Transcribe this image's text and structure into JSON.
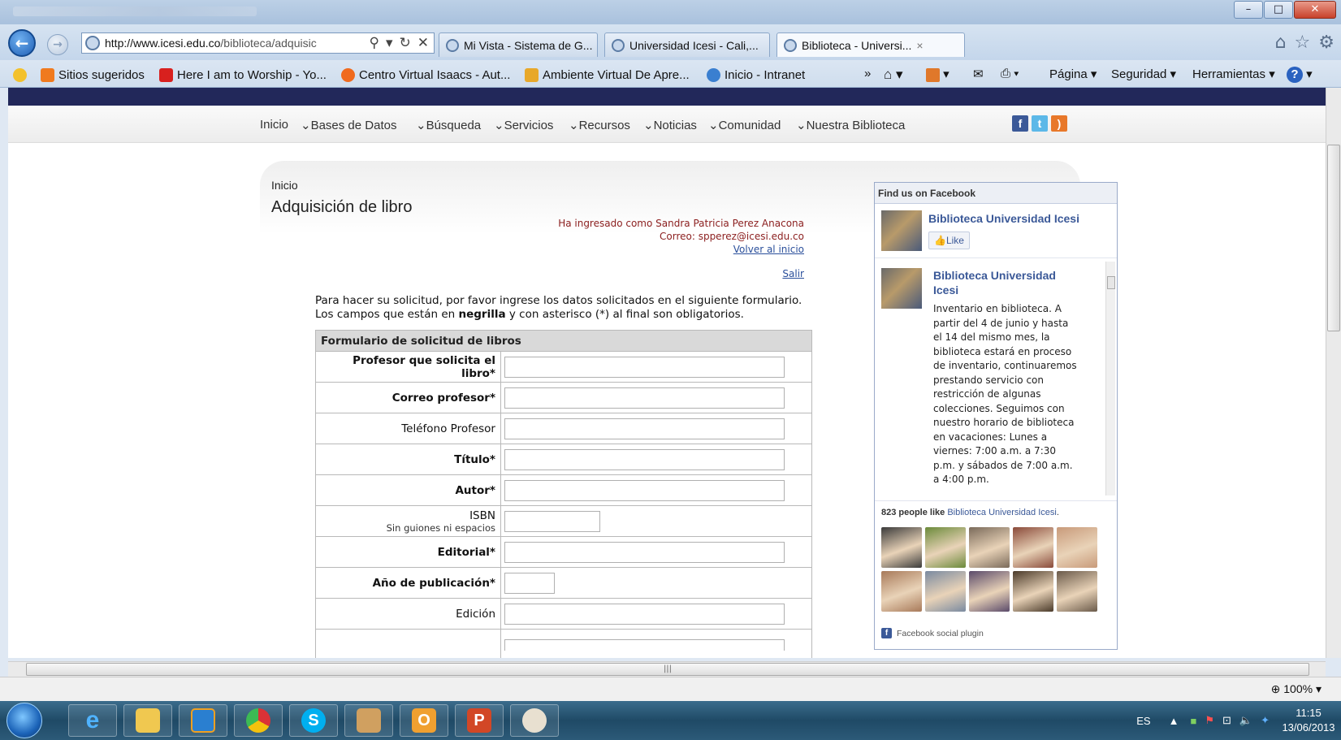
{
  "browser": {
    "url_domain": "http://www.icesi.edu.co",
    "url_path": "/biblioteca/adquisic",
    "tabs": [
      {
        "label": "Mi Vista - Sistema de G..."
      },
      {
        "label": "Universidad Icesi - Cali,..."
      },
      {
        "label": "Biblioteca - Universi..."
      }
    ],
    "favorites": [
      {
        "label": "Sitios sugeridos"
      },
      {
        "label": "Here I am to Worship - Yo..."
      },
      {
        "label": "Centro Virtual Isaacs - Aut..."
      },
      {
        "label": "Ambiente Virtual De Apre..."
      },
      {
        "label": "Inicio - Intranet"
      }
    ],
    "commands": {
      "page": "Página ▾",
      "security": "Seguridad ▾",
      "tools": "Herramientas ▾"
    },
    "zoom": "100%"
  },
  "site": {
    "menu": [
      "Inicio",
      "Bases de Datos",
      "Búsqueda",
      "Servicios",
      "Recursos",
      "Noticias",
      "Comunidad",
      "Nuestra Biblioteca"
    ],
    "breadcrumb": "Inicio",
    "title": "Adquisición de libro",
    "session": {
      "user": "Ha ingresado como Sandra Patricia Perez Anacona",
      "email": "Correo: spperez@icesi.edu.co",
      "home_link": "Volver al inicio",
      "exit_link": "Salir"
    },
    "intro": {
      "line1": "Para hacer su solicitud, por favor ingrese los datos solicitados en el siguiente formulario.",
      "line2_a": "Los campos que están en ",
      "line2_bold": "negrilla",
      "line2_b": " y con asterisco (*) al final son obligatorios."
    },
    "form": {
      "heading": "Formulario de solicitud de libros",
      "fields": {
        "professor": "Profesor que solicita el libro*",
        "email": "Correo profesor*",
        "phone": "Teléfono Profesor",
        "title": "Título*",
        "author": "Autor*",
        "isbn": "ISBN",
        "isbn_hint": "Sin guiones ni espacios",
        "publisher": "Editorial*",
        "year": "Año de publicación*",
        "edition": "Edición"
      }
    }
  },
  "facebook": {
    "header": "Find us on Facebook",
    "page_name": "Biblioteca Universidad Icesi",
    "like": "Like",
    "post_author": "Biblioteca Universidad Icesi",
    "post_text": "Inventario en biblioteca. A partir del 4 de junio y hasta el 14 del mismo mes, la biblioteca estará en proceso de inventario, continuaremos prestando servicio con restricción de algunas colecciones. Seguimos con nuestro horario de biblioteca en vacaciones: Lunes a viernes: 7:00 a.m. a 7:30 p.m. y sábados de 7:00 a.m. a 4:00 p.m.",
    "likes_count": "823 people like",
    "likes_link": "Biblioteca Universidad Icesi",
    "plugin_label": "Facebook social plugin",
    "face_colors": [
      "#3a3a3a",
      "#6b8a3a",
      "#7a6a5a",
      "#8a4a3a",
      "#c89a7a",
      "#a87a5a",
      "#7a8aa0",
      "#5a4a6a",
      "#4a3a2a",
      "#6a5a4a"
    ]
  },
  "taskbar": {
    "lang": "ES",
    "time": "11:15",
    "date": "13/06/2013"
  },
  "colors": {
    "site_topbar": "#22285a",
    "session_red": "#8b1e1e",
    "link_blue": "#2a4f9b",
    "facebook_blue": "#3b5998"
  }
}
